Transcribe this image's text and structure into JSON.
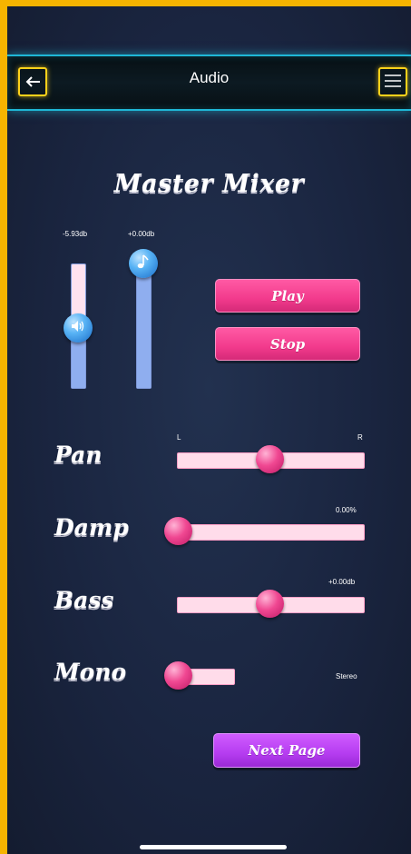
{
  "header": {
    "title": "Audio",
    "back_icon": "back-arrow-icon",
    "menu_icon": "hamburger-menu-icon"
  },
  "mixer": {
    "heading": "Master Mixer",
    "volume": {
      "label": "-5.93db",
      "level": 0.48,
      "icon": "speaker-icon"
    },
    "music": {
      "label": "+0.00db",
      "level": 1.0,
      "icon": "music-note-icon"
    },
    "play_label": "Play",
    "stop_label": "Stop"
  },
  "controls": {
    "pan": {
      "label": "Pan",
      "left_label": "L",
      "right_label": "R",
      "value": 0.5
    },
    "damp": {
      "label": "Damp",
      "value_label": "0.00%",
      "value": 0.0
    },
    "bass": {
      "label": "Bass",
      "value_label": "+0.00db",
      "value": 0.5
    },
    "mono": {
      "label": "Mono",
      "value_label": "Stereo",
      "value": 0.0
    }
  },
  "next_page_label": "Next Page",
  "colors": {
    "accent_pink": "#f23a8c",
    "accent_purple": "#b53cf0",
    "header_glow": "#1fb7d6",
    "frame": "#f6b400"
  }
}
